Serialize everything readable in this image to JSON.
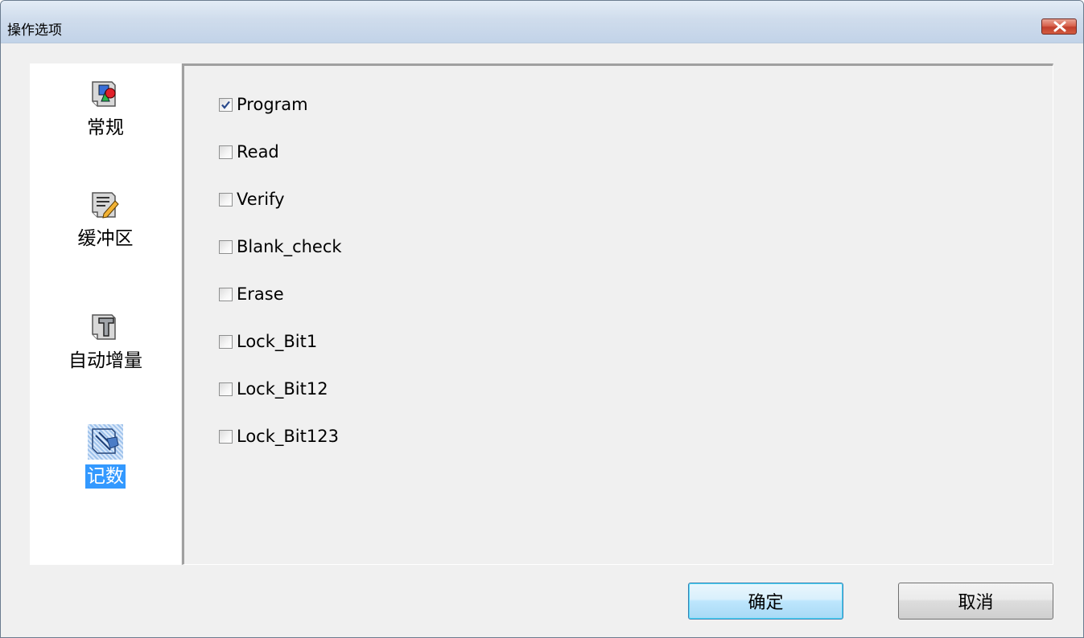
{
  "window": {
    "title": "操作选项"
  },
  "sidebar": {
    "items": [
      {
        "label": "常规",
        "icon": "shapes-icon",
        "selected": false
      },
      {
        "label": "缓冲区",
        "icon": "pencil-document-icon",
        "selected": false
      },
      {
        "label": "自动增量",
        "icon": "text-t-icon",
        "selected": false
      },
      {
        "label": "记数",
        "icon": "tally-icon",
        "selected": true
      }
    ]
  },
  "options": [
    {
      "label": "Program",
      "checked": true
    },
    {
      "label": "Read",
      "checked": false
    },
    {
      "label": "Verify",
      "checked": false
    },
    {
      "label": "Blank_check",
      "checked": false
    },
    {
      "label": "Erase",
      "checked": false
    },
    {
      "label": "Lock_Bit1",
      "checked": false
    },
    {
      "label": "Lock_Bit12",
      "checked": false
    },
    {
      "label": "Lock_Bit123",
      "checked": false
    }
  ],
  "buttons": {
    "ok": "确定",
    "cancel": "取消"
  },
  "colors": {
    "selection": "#3399ff",
    "close": "#c13f2c"
  }
}
